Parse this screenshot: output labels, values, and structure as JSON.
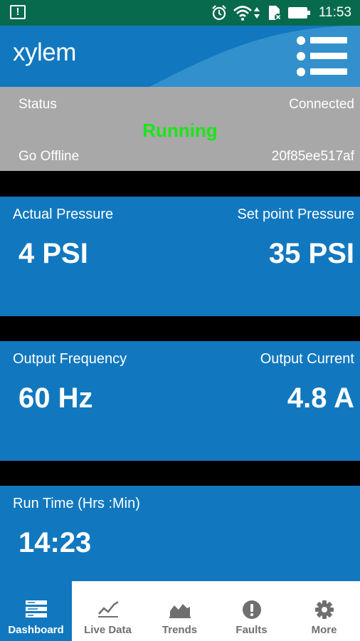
{
  "status_bar": {
    "time": "11:53",
    "icons": [
      "alert-icon",
      "alarm-clock-icon",
      "wifi-icon",
      "sim-icon",
      "battery-icon"
    ]
  },
  "header": {
    "logo_text": "xylem",
    "menu_icon": "menu-icon"
  },
  "status_panel": {
    "status_label": "Status",
    "connection_state": "Connected",
    "run_state": "Running",
    "go_offline_label": "Go Offline",
    "device_id": "20f85ee517af",
    "run_state_color": "#19e619"
  },
  "cards": {
    "pressure": {
      "actual_label": "Actual Pressure",
      "actual_value": "4 PSI",
      "setpoint_label": "Set point Pressure",
      "setpoint_value": "35 PSI"
    },
    "electrical": {
      "frequency_label": "Output Frequency",
      "frequency_value": "60 Hz",
      "current_label": "Output Current",
      "current_value": "4.8 A"
    },
    "runtime": {
      "label": "Run Time (Hrs :Min)",
      "value": "14:23"
    }
  },
  "tabs": [
    {
      "label": "Dashboard",
      "icon": "dashboard-icon",
      "active": true
    },
    {
      "label": "Live Data",
      "icon": "line-chart-icon",
      "active": false
    },
    {
      "label": "Trends",
      "icon": "area-chart-icon",
      "active": false
    },
    {
      "label": "Faults",
      "icon": "exclamation-icon",
      "active": false
    },
    {
      "label": "More",
      "icon": "gear-icon",
      "active": false
    }
  ],
  "colors": {
    "brand_blue": "#1178bf",
    "status_bar": "#086a4c",
    "panel_gray": "#a8a8a8",
    "inactive_tab": "#6f6f6f"
  }
}
